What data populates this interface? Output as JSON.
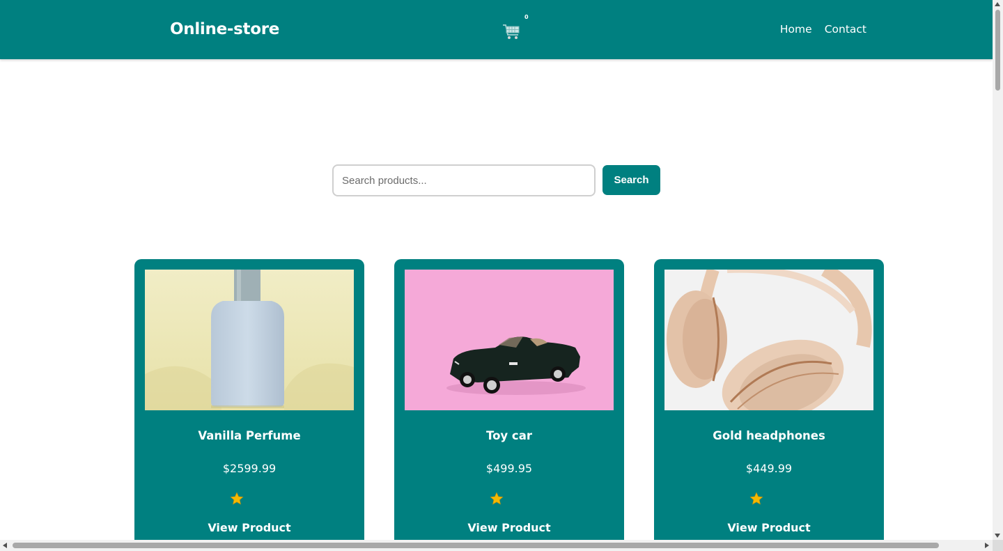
{
  "header": {
    "brand": "Online-store",
    "cart_count": "0",
    "nav": [
      "Home",
      "Contact"
    ]
  },
  "search": {
    "placeholder": "Search products...",
    "value": "",
    "button_label": "Search"
  },
  "products": [
    {
      "title": "Vanilla Perfume",
      "price": "$2599.99",
      "rating": 1,
      "link_label": "View Product",
      "image": "perfume-bottle-image"
    },
    {
      "title": "Toy car",
      "price": "$499.95",
      "rating": 1,
      "link_label": "View Product",
      "image": "toy-car-image"
    },
    {
      "title": "Gold headphones",
      "price": "$449.99",
      "rating": 1,
      "link_label": "View Product",
      "image": "headphones-image"
    }
  ],
  "colors": {
    "primary": "#008080",
    "star": "#f5b800",
    "white": "#ffffff"
  },
  "icons": {
    "cart": "shopping-cart-icon",
    "star": "star-icon"
  }
}
